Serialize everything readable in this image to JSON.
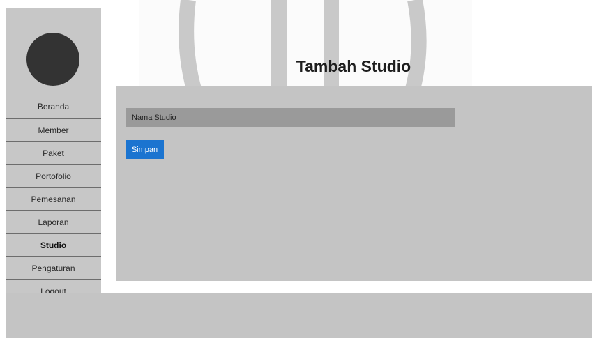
{
  "header": {
    "title": "Tambah Studio"
  },
  "sidebar": {
    "items": [
      {
        "label": "Beranda",
        "active": false
      },
      {
        "label": "Member",
        "active": false
      },
      {
        "label": "Paket",
        "active": false
      },
      {
        "label": "Portofolio",
        "active": false
      },
      {
        "label": "Pemesanan",
        "active": false
      },
      {
        "label": "Laporan",
        "active": false
      },
      {
        "label": "Studio",
        "active": true
      },
      {
        "label": "Pengaturan",
        "active": false
      },
      {
        "label": "Logout",
        "active": false
      }
    ]
  },
  "form": {
    "name_field": {
      "value": "",
      "placeholder": "Nama Studio"
    },
    "submit_label": "Simpan"
  },
  "colors": {
    "panel": "#c4c4c4",
    "field": "#9a9a9a",
    "button": "#1b74d0",
    "avatar": "#333333"
  }
}
